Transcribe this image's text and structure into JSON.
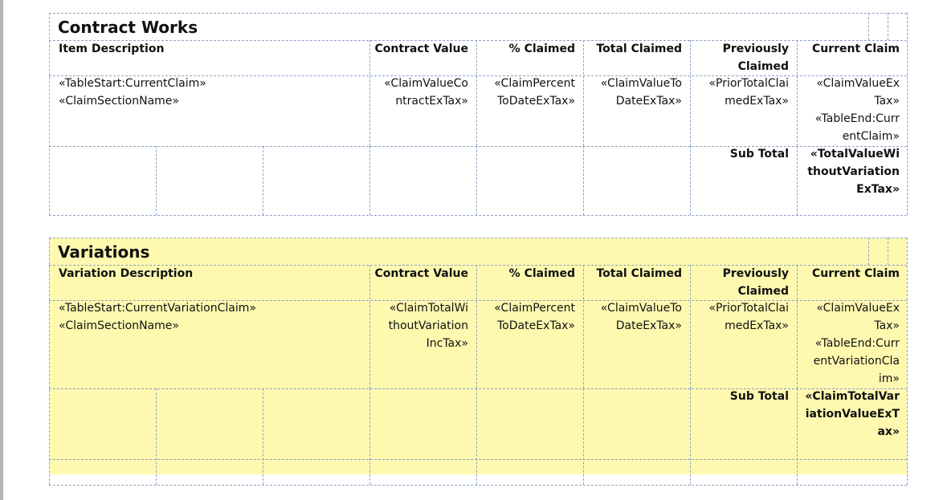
{
  "contract_works": {
    "title": "Contract Works",
    "headers": {
      "description": "Item Description",
      "contract_value": "Contract Value",
      "pct_claimed": "% Claimed",
      "total_claimed": "Total Claimed",
      "previously_claimed": [
        "Previously",
        "Claimed"
      ],
      "current_claim": "Current Claim"
    },
    "row": {
      "description": [
        "«TableStart:CurrentClaim»",
        "«ClaimSectionName»"
      ],
      "contract_value": [
        "«ClaimValueCo",
        "ntractExTax»"
      ],
      "pct_claimed": [
        "«ClaimPercent",
        "ToDateExTax»"
      ],
      "total_claimed": [
        "«ClaimValueTo",
        "DateExTax»"
      ],
      "previously_claimed": [
        "«PriorTotalClai",
        "medExTax»"
      ],
      "current_claim": [
        "«ClaimValueEx",
        "Tax»",
        "«TableEnd:Curr",
        "entClaim»"
      ]
    },
    "subtotal": {
      "label": "Sub Total",
      "value": [
        "«TotalValueWi",
        "thoutVariation",
        "ExTax»"
      ]
    }
  },
  "variations": {
    "title": "Variations",
    "headers": {
      "description": "Variation Description",
      "contract_value": "Contract Value",
      "pct_claimed": "% Claimed",
      "total_claimed": "Total Claimed",
      "previously_claimed": [
        "Previously",
        "Claimed"
      ],
      "current_claim": "Current Claim"
    },
    "row": {
      "description": [
        "«TableStart:CurrentVariationClaim»",
        "«ClaimSectionName»"
      ],
      "contract_value": [
        "«ClaimTotalWi",
        "thoutVariation",
        "IncTax»"
      ],
      "pct_claimed": [
        "«ClaimPercent",
        "ToDateExTax»"
      ],
      "total_claimed": [
        "«ClaimValueTo",
        "DateExTax»"
      ],
      "previously_claimed": [
        "«PriorTotalClai",
        "medExTax»"
      ],
      "current_claim": [
        "«ClaimValueEx",
        "Tax»",
        "«TableEnd:Curr",
        "entVariationCla",
        "im»"
      ]
    },
    "subtotal": {
      "label": "Sub Total",
      "value": [
        "«ClaimTotalVar",
        "iationValueExT",
        "ax»"
      ]
    }
  },
  "colors": {
    "variations_fill": "#fff9b0",
    "grid_line": "#8ea2c4",
    "gutter": "#b5b5b5"
  }
}
